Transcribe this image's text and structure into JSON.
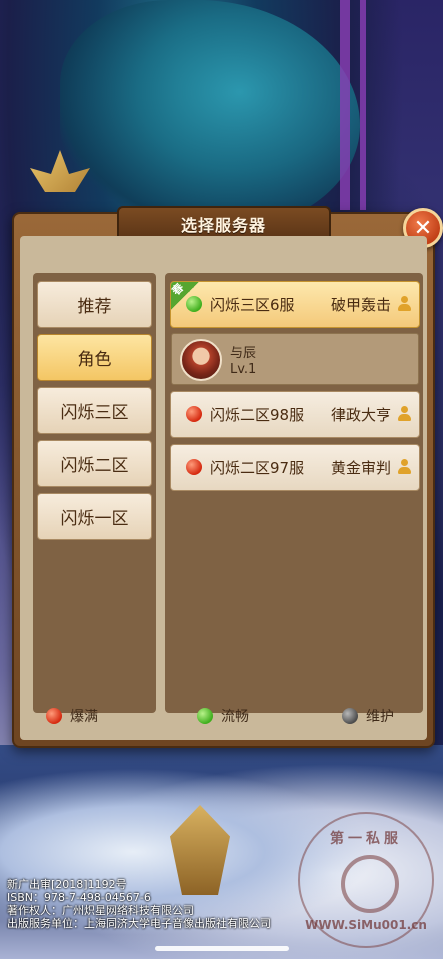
{
  "panel": {
    "title": "选择服务器",
    "close_icon": "close-x-icon"
  },
  "tabs": [
    {
      "label": "推荐",
      "active": false
    },
    {
      "label": "角色",
      "active": true
    },
    {
      "label": "闪烁三区",
      "active": false
    },
    {
      "label": "闪烁二区",
      "active": false
    },
    {
      "label": "闪烁一区",
      "active": false
    }
  ],
  "servers": [
    {
      "name": "闪烁三区6服",
      "role": "破甲轰击",
      "status": "green",
      "badge": "春"
    },
    {
      "name": "闪烁二区98服",
      "role": "律政大亨",
      "status": "red"
    },
    {
      "name": "闪烁二区97服",
      "role": "黄金审判",
      "status": "red"
    }
  ],
  "character": {
    "name": "与辰",
    "level": "Lv.1"
  },
  "legend": [
    {
      "label": "爆满",
      "color": "red"
    },
    {
      "label": "流畅",
      "color": "green"
    },
    {
      "label": "维护",
      "color": "gray"
    }
  ],
  "footer": {
    "line1": "新广出审[2018]1192号",
    "line2": "ISBN：978-7-498-04567-6",
    "line3": "著作权人：广州炽星网络科技有限公司",
    "line4": "出版服务单位：上海同济大学电子音像出版社有限公司"
  },
  "watermark": {
    "top": "第一私服",
    "bottom": "WWW.SiMu001.cn"
  }
}
